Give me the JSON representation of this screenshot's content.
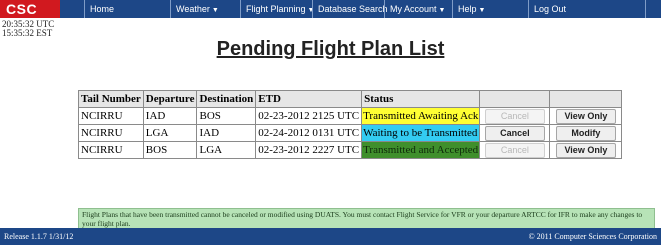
{
  "header": {
    "logo": "CSC",
    "nav": [
      {
        "label": "Home",
        "caret": ""
      },
      {
        "label": "Weather",
        "caret": "▼"
      },
      {
        "label": "Flight Planning",
        "caret": "▼"
      },
      {
        "label": "Database Search",
        "caret": ""
      },
      {
        "label": "My Account",
        "caret": "▼"
      },
      {
        "label": "Help",
        "caret": "▼"
      },
      {
        "label": "Log Out",
        "caret": ""
      }
    ]
  },
  "clock": {
    "utc": "20:35:32 UTC",
    "est": "15:35:32 EST"
  },
  "page_title": "Pending Flight Plan List",
  "table": {
    "headers": [
      "Tail Number",
      "Departure",
      "Destination",
      "ETD",
      "Status",
      "",
      ""
    ],
    "rows": [
      {
        "tail": "NCIRRU",
        "dep": "IAD",
        "dest": "BOS",
        "etd": "02-23-2012 2125 UTC",
        "status": "Transmitted Awaiting Ack",
        "status_color": "#ffff33",
        "cancel": "Cancel",
        "cancel_enabled": false,
        "action": "View Only"
      },
      {
        "tail": "NCIRRU",
        "dep": "LGA",
        "dest": "IAD",
        "etd": "02-24-2012 0131 UTC",
        "status": "Waiting to be Transmitted",
        "status_color": "#33ccf2",
        "cancel": "Cancel",
        "cancel_enabled": true,
        "action": "Modify"
      },
      {
        "tail": "NCIRRU",
        "dep": "BOS",
        "dest": "LGA",
        "etd": "02-23-2012 2227 UTC",
        "status": "Transmitted and Accepted",
        "status_color": "#3f8f2c",
        "cancel": "Cancel",
        "cancel_enabled": false,
        "action": "View Only"
      }
    ]
  },
  "notice": "Flight Plans that have been transmitted cannot be canceled or modified using DUATS. You must contact Flight Service for VFR or your departure ARTCC for IFR to make any changes to your flight plan.",
  "footer": {
    "release": "Release 1.1.7 1/31/12",
    "copyright": "© 2011 Computer Sciences Corporation"
  },
  "colors": {
    "nav_bg": "#1d4787",
    "logo_bg": "#d1191f",
    "notice_bg": "#b7e3b7"
  }
}
